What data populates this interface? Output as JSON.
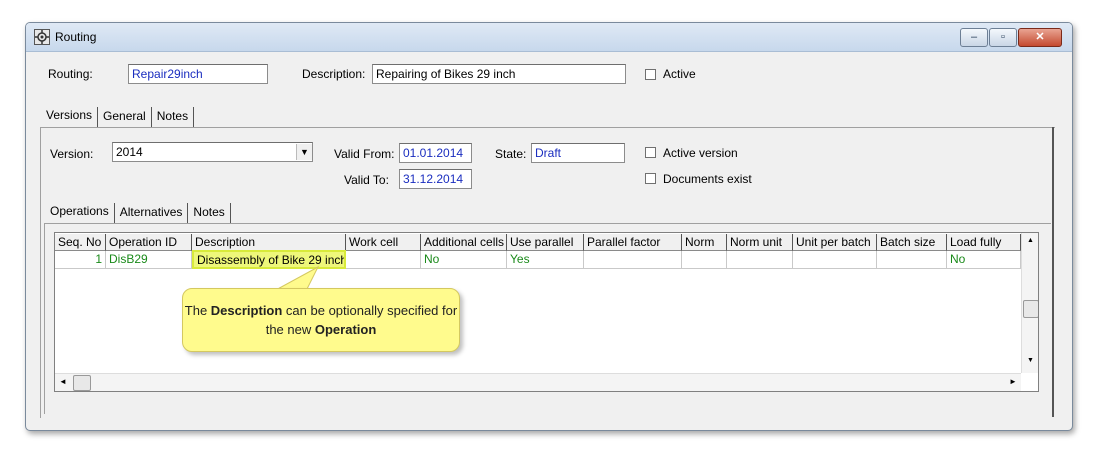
{
  "window": {
    "title": "Routing",
    "minimize_glyph": "–",
    "maximize_glyph": "▫",
    "close_glyph": "✕"
  },
  "header": {
    "routing_label": "Routing:",
    "routing_value": "Repair29inch",
    "description_label": "Description:",
    "description_value": "Repairing of Bikes 29 inch",
    "active_label": "Active"
  },
  "tabs": [
    {
      "label": "Versions"
    },
    {
      "label": "General"
    },
    {
      "label": "Notes"
    }
  ],
  "version": {
    "version_label": "Version:",
    "version_value": "2014",
    "valid_from_label": "Valid From:",
    "valid_from_value": "01.01.2014",
    "valid_to_label": "Valid To:",
    "valid_to_value": "31.12.2014",
    "state_label": "State:",
    "state_value": "Draft",
    "active_version_label": "Active version",
    "documents_exist_label": "Documents exist"
  },
  "subtabs": [
    {
      "label": "Operations"
    },
    {
      "label": "Alternatives"
    },
    {
      "label": "Notes"
    }
  ],
  "grid": {
    "columns": [
      "Seq. No",
      "Operation ID",
      "Description",
      "Work cell",
      "Additional cells",
      "Use parallel",
      "Parallel factor",
      "Norm",
      "Norm unit",
      "Unit per batch",
      "Batch size",
      "Load fully"
    ],
    "rows": [
      {
        "seq_no": "1",
        "operation_id": "DisB29",
        "description": "Disassembly of Bike 29 inch",
        "work_cell": "",
        "additional_cells": "No",
        "use_parallel": "Yes",
        "parallel_factor": "",
        "norm": "",
        "norm_unit": "",
        "unit_per_batch": "",
        "batch_size": "",
        "load_fully": "No"
      }
    ]
  },
  "callout": {
    "part1": "The ",
    "bold1": "Description",
    "part2": " can be optionally specified for the new ",
    "bold2": "Operation"
  },
  "scroll": {
    "up_glyph": "▲",
    "down_glyph": "▼",
    "left_glyph": "◄",
    "right_glyph": "►"
  },
  "colors": {
    "field_text": "#1a2dbf",
    "green_text": "#1a8a1a",
    "callout_bg": "#fffb8d"
  }
}
